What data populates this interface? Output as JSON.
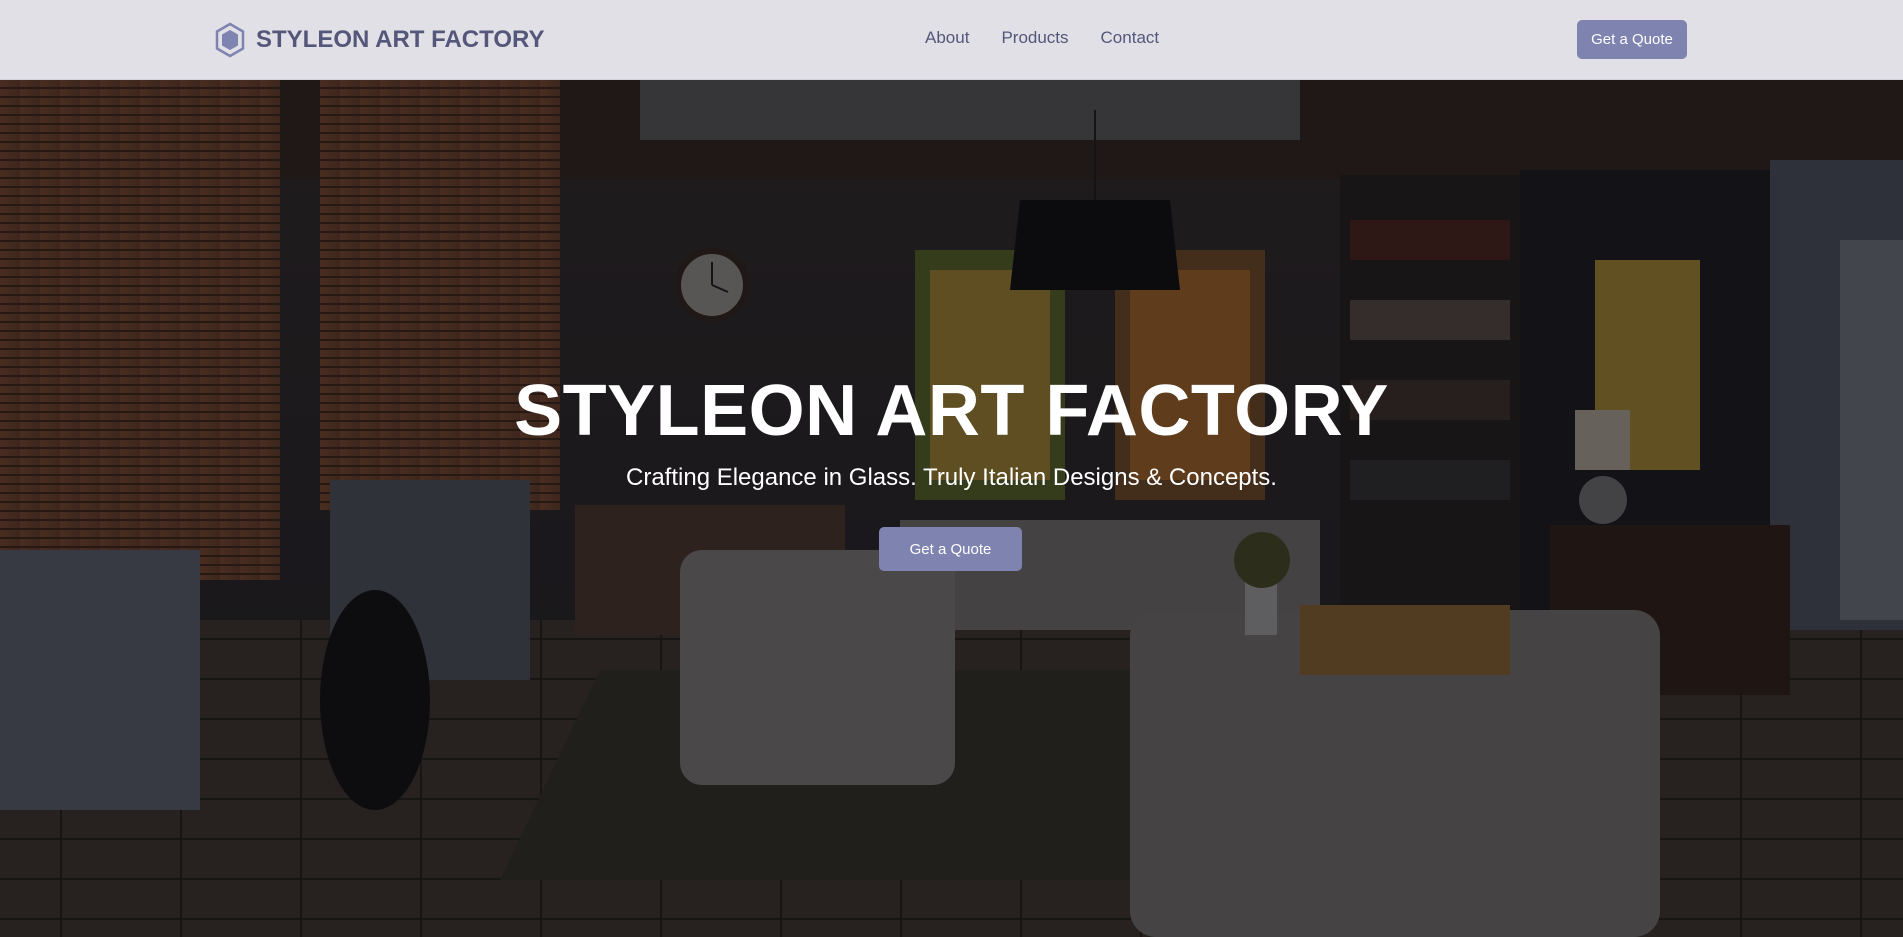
{
  "navbar": {
    "brand": {
      "icon": "hexagon-logo-icon",
      "name": "STYLEON ART FACTORY"
    },
    "links": [
      {
        "label": "About"
      },
      {
        "label": "Products"
      },
      {
        "label": "Contact"
      }
    ],
    "cta_label": "Get a Quote"
  },
  "hero": {
    "background": "living-room-photo",
    "title": "STYLEON ART FACTORY",
    "subtitle": "Crafting Elegance in Glass. Truly Italian Designs & Concepts.",
    "cta_label": "Get a Quote"
  },
  "colors": {
    "accent": "#7f83b0",
    "navbar_bg": "#e0e0e6",
    "brand_text": "#55577a",
    "hero_text": "#ffffff"
  }
}
